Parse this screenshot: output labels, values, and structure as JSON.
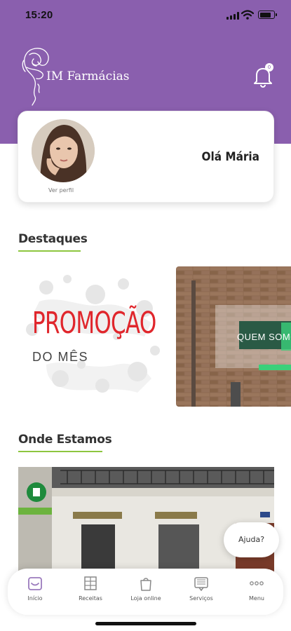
{
  "status_bar": {
    "time": "15:20",
    "battery_level": 0.85
  },
  "header": {
    "brand_name": "IM Farmácias",
    "notification_count": "0",
    "bg_color": "#8a5fae"
  },
  "profile": {
    "link_label": "Ver perfil",
    "greeting": "Olá Mária"
  },
  "sections": {
    "highlights_title": "Destaques",
    "location_title": "Onde Estamos"
  },
  "highlights": {
    "promo_title": "PROMOÇÃO",
    "promo_subtitle": "DO MÊS",
    "about_label": "QUEM SOMOS"
  },
  "help_button": {
    "label": "Ajuda?"
  },
  "tabs": [
    {
      "label": "Início",
      "icon": "home-icon"
    },
    {
      "label": "Receitas",
      "icon": "prescription-icon"
    },
    {
      "label": "Loja online",
      "icon": "shopping-bag-icon"
    },
    {
      "label": "Serviços",
      "icon": "services-icon"
    },
    {
      "label": "Menu",
      "icon": "more-dots-icon"
    }
  ],
  "colors": {
    "accent": "#8a5fae",
    "underline": "#8dc63f",
    "promo_red": "#e0262c"
  }
}
